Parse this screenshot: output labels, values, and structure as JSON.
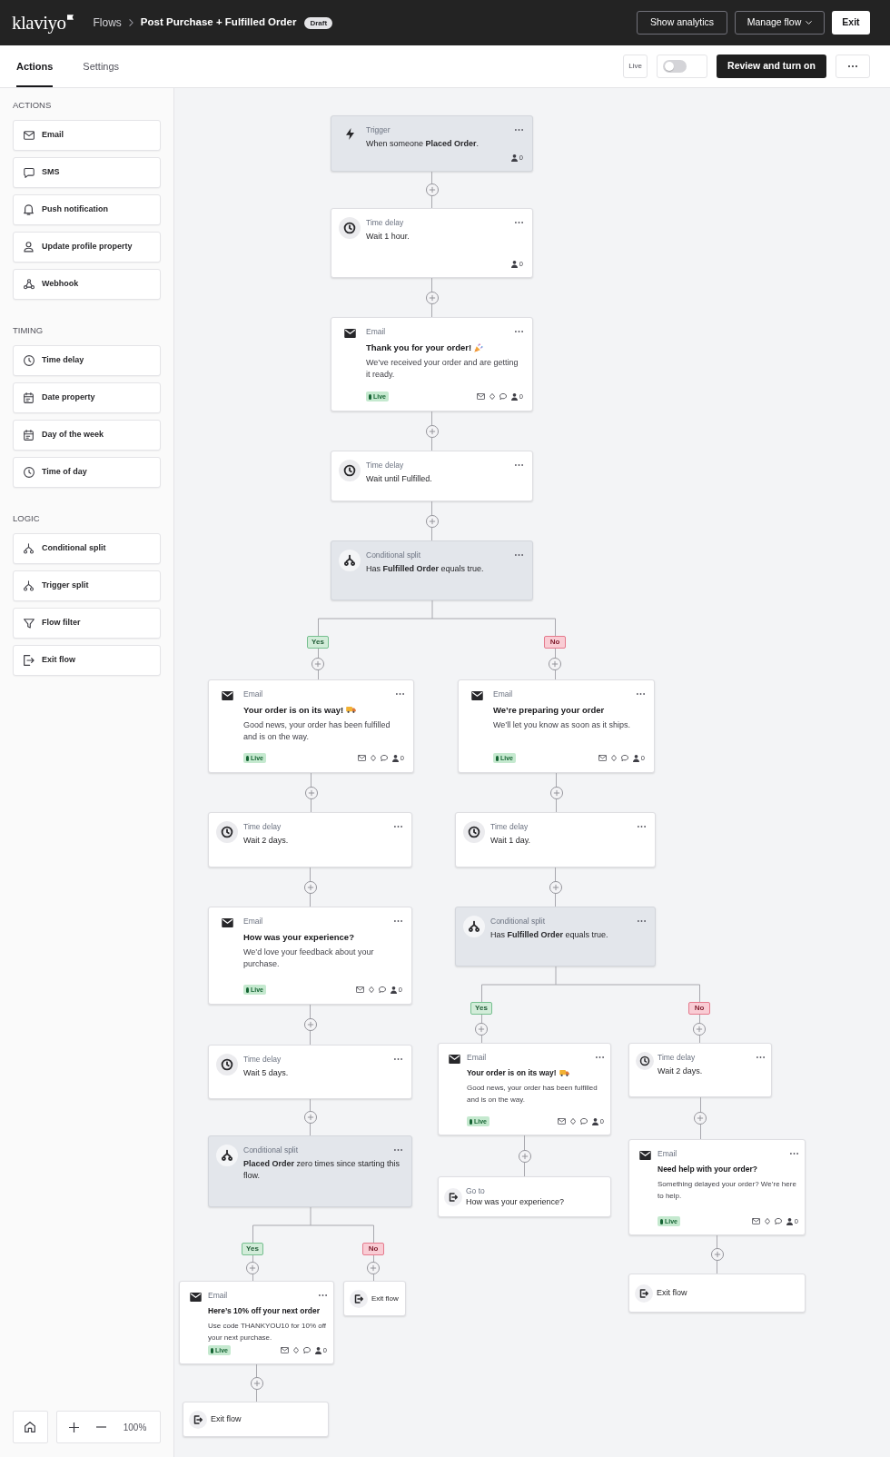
{
  "header": {
    "logo": "klaviyo",
    "breadcrumbs": [
      {
        "label": "Flows",
        "kind": "link"
      },
      {
        "label": "Post Purchase + Fulfilled Order",
        "kind": "current"
      }
    ],
    "status_badge": "Draft",
    "buttons": [
      {
        "label": "Show analytics",
        "kind": "outline"
      },
      {
        "label": "Manage flow",
        "kind": "menu"
      },
      {
        "label": "Exit",
        "kind": "light"
      }
    ]
  },
  "toolbar": {
    "tabs": [
      {
        "label": "Actions",
        "selected": true
      },
      {
        "label": "Settings",
        "selected": false
      }
    ],
    "live_label": "Live",
    "live_toggle": {
      "on": false
    },
    "primary_button": "Review and turn on"
  },
  "sidebar": {
    "sections": [
      {
        "title": "ACTIONS",
        "items": [
          {
            "label": "Email",
            "kind": "email"
          },
          {
            "label": "SMS",
            "kind": "sms"
          },
          {
            "label": "Push notification",
            "kind": "push"
          },
          {
            "label": "Update profile property",
            "kind": "profile"
          },
          {
            "label": "Webhook",
            "kind": "webhook"
          }
        ]
      },
      {
        "title": "TIMING",
        "items": [
          {
            "label": "Time delay",
            "kind": "time_delay"
          },
          {
            "label": "Date property",
            "kind": "date_property"
          },
          {
            "label": "Day of the week",
            "kind": "day_of_week"
          },
          {
            "label": "Time of day",
            "kind": "time_of_day"
          }
        ]
      },
      {
        "title": "LOGIC",
        "items": [
          {
            "label": "Conditional split",
            "kind": "conditional_split"
          },
          {
            "label": "Trigger split",
            "kind": "trigger_split"
          },
          {
            "label": "Flow filter",
            "kind": "flow_filter"
          },
          {
            "label": "Exit flow",
            "kind": "exit"
          }
        ]
      }
    ],
    "zoom": "100%"
  },
  "flow": {
    "steps": [
      {
        "kind": "trigger",
        "type_label": "Trigger",
        "text": "When someone **Placed Order**.",
        "count": "0"
      },
      {
        "kind": "time_delay",
        "type_label": "Time delay",
        "text": "Wait 1 hour.",
        "count": "0"
      },
      {
        "kind": "email",
        "type_label": "Email",
        "title": "Thank you for your order!",
        "title_icon": {
          "kind": "party"
        },
        "description": "We’ve received your order and are getting it ready.",
        "status": "Live",
        "count": "0"
      },
      {
        "kind": "time_delay",
        "type_label": "Time delay",
        "text": "Wait until Fulfilled."
      },
      {
        "kind": "split",
        "type_label": "Conditional split",
        "text": "Has **Fulfilled Order** equals true.",
        "branches": [
          {
            "label": "Yes",
            "kind": "yes",
            "steps": [
              {
                "kind": "email",
                "type_label": "Email",
                "title": "Your order is on its way!",
                "title_icon": {
                  "kind": "truck"
                },
                "description": "Good news, your order has been fulfilled and is on the way.",
                "status": "Live",
                "count": "0"
              },
              {
                "kind": "time_delay",
                "type_label": "Time delay",
                "text": "Wait 2 days."
              },
              {
                "kind": "email",
                "type_label": "Email",
                "title": "How was your experience?",
                "description": "We’d love your feedback about your purchase.",
                "status": "Live",
                "count": "0"
              },
              {
                "kind": "time_delay",
                "type_label": "Time delay",
                "text": "Wait 5 days."
              },
              {
                "kind": "split",
                "type_label": "Conditional split",
                "text": "**Placed Order** zero times since starting this flow.",
                "branches": [
                  {
                    "label": "Yes",
                    "kind": "yes",
                    "steps": [
                      {
                        "kind": "email",
                        "type_label": "Email",
                        "title": "Here’s 10% off your next order",
                        "description": "Use code THANKYOU10 for 10% off your next purchase.",
                        "status": "Live",
                        "count": "0"
                      },
                      {
                        "kind": "exit",
                        "text": "Exit flow"
                      }
                    ]
                  },
                  {
                    "label": "No",
                    "kind": "no",
                    "steps": [
                      {
                        "kind": "exit",
                        "text": "Exit flow"
                      }
                    ]
                  }
                ]
              }
            ]
          },
          {
            "label": "No",
            "kind": "no",
            "steps": [
              {
                "kind": "email",
                "type_label": "Email",
                "title": "We’re preparing your order",
                "description": "We’ll let you know as soon as it ships.",
                "status": "Live",
                "count": "0"
              },
              {
                "kind": "time_delay",
                "type_label": "Time delay",
                "text": "Wait 1 day."
              },
              {
                "kind": "split",
                "type_label": "Conditional split",
                "text": "Has **Fulfilled Order** equals true.",
                "branches": [
                  {
                    "label": "Yes",
                    "kind": "yes",
                    "steps": [
                      {
                        "kind": "email",
                        "type_label": "Email",
                        "title": "Your order is on its way!",
                        "title_icon": {
                          "kind": "truck"
                        },
                        "description": "Good news, your order has been fulfilled and is on the way.",
                        "status": "Live",
                        "count": "0"
                      },
                      {
                        "kind": "go_to",
                        "type_label": "Go to",
                        "text": "How was your experience?"
                      }
                    ]
                  },
                  {
                    "label": "No",
                    "kind": "no",
                    "steps": [
                      {
                        "kind": "time_delay",
                        "type_label": "Time delay",
                        "text": "Wait 2 days."
                      },
                      {
                        "kind": "email",
                        "type_label": "Email",
                        "title": "Need help with your order?",
                        "description": "Something delayed your order? We’re here to help.",
                        "status": "Live",
                        "count": "0"
                      },
                      {
                        "kind": "exit",
                        "text": "Exit flow"
                      }
                    ]
                  }
                ]
              }
            ]
          }
        ]
      }
    ]
  }
}
